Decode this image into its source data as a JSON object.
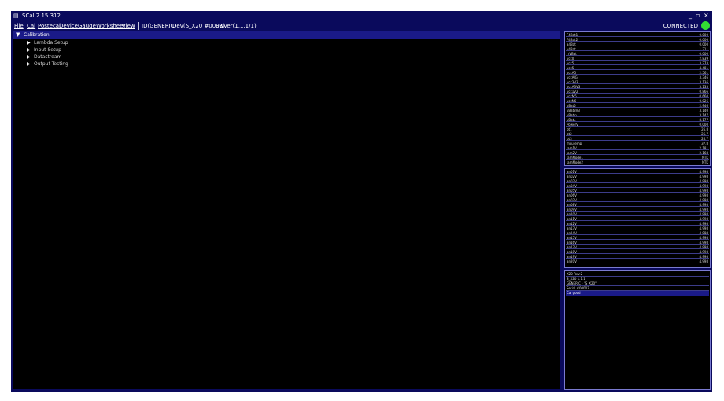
{
  "window": {
    "title": "SCal 2.15.312",
    "minimize": "_",
    "restore": "▫",
    "close": "×"
  },
  "menu": {
    "items": [
      "File",
      "Cal",
      "Postecal",
      "Device",
      "Gauge",
      "Worksheet",
      "View"
    ]
  },
  "device_info": {
    "id": "ID(GENERIC)",
    "dev": "Dev(S_X20 #0003)",
    "swver": "SwVer(1.1.1/1)"
  },
  "status": {
    "text": "CONNECTED",
    "color": "#33dd33"
  },
  "tree": {
    "header": "Calibration",
    "items": [
      "Lambda Setup",
      "Input Setup",
      "Datastream",
      "Output Testing"
    ]
  },
  "sensors": [
    {
      "label": "F4Bat1",
      "value": "0.000"
    },
    {
      "label": "F4Bat2",
      "value": "0.000"
    },
    {
      "label": "a4Bat",
      "value": "0.000"
    },
    {
      "label": "v4Bat",
      "value": "1.311"
    },
    {
      "label": "rrVBat",
      "value": "0.000"
    },
    {
      "label": "vcc0",
      "value": "2.839"
    },
    {
      "label": "vcc5",
      "value": "3.273"
    },
    {
      "label": "vcc5",
      "value": "4.481"
    },
    {
      "label": "vccA5",
      "value": "2.561"
    },
    {
      "label": "vccAIG",
      "value": "3.346"
    },
    {
      "label": "vcc3V3",
      "value": "3.136"
    },
    {
      "label": "vccA3V3",
      "value": "3.133"
    },
    {
      "label": "vcc1V2",
      "value": "0.866"
    },
    {
      "label": "vccM5",
      "value": "0.660"
    },
    {
      "label": "vccN6",
      "value": "0.026"
    },
    {
      "label": "vBat5",
      "value": "2.946"
    },
    {
      "label": "vBat3V3",
      "value": "3.140"
    },
    {
      "label": "vBatIn",
      "value": "3.147"
    },
    {
      "label": "vBatL",
      "value": "8.177"
    },
    {
      "label": "PowerV",
      "value": "0.000"
    },
    {
      "label": "bt1",
      "value": "26.8"
    },
    {
      "label": "bt2",
      "value": "26.7"
    },
    {
      "label": "bt3",
      "value": "26.7"
    },
    {
      "label": "mcuTemp",
      "value": "37.8"
    },
    {
      "label": "lam1V",
      "value": "2.181"
    },
    {
      "label": "lam2V",
      "value": "2.168"
    },
    {
      "label": "lamMode1",
      "value": "NTK"
    },
    {
      "label": "lamMode2",
      "value": "NTK"
    }
  ],
  "analog_inputs": [
    {
      "label": "an01V",
      "value": "4.998"
    },
    {
      "label": "an02V",
      "value": "4.998"
    },
    {
      "label": "an03V",
      "value": "4.998"
    },
    {
      "label": "an04V",
      "value": "4.998"
    },
    {
      "label": "an05V",
      "value": "4.998"
    },
    {
      "label": "an06V",
      "value": "4.998"
    },
    {
      "label": "an07V",
      "value": "4.998"
    },
    {
      "label": "an08V",
      "value": "4.998"
    },
    {
      "label": "an09V",
      "value": "4.998"
    },
    {
      "label": "an10V",
      "value": "4.998"
    },
    {
      "label": "an11V",
      "value": "4.998"
    },
    {
      "label": "an12V",
      "value": "4.998"
    },
    {
      "label": "an13V",
      "value": "4.998"
    },
    {
      "label": "an14V",
      "value": "4.998"
    },
    {
      "label": "an15V",
      "value": "4.998"
    },
    {
      "label": "an16V",
      "value": "4.998"
    },
    {
      "label": "an17V",
      "value": "4.998"
    },
    {
      "label": "an18V",
      "value": "4.998"
    },
    {
      "label": "an19V",
      "value": "4.998"
    },
    {
      "label": "an20V",
      "value": "4.998"
    }
  ],
  "device_details": [
    "X20 Rev:2",
    "S_X20 1.1.1",
    "GENERIC - \"S_X20\"",
    "Serial #00003"
  ],
  "cal_status": "Cal good"
}
